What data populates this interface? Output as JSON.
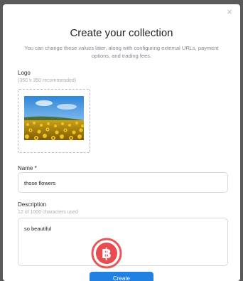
{
  "modal": {
    "close_label": "×",
    "title": "Create your collection",
    "subtitle": "You can change these values later, along with configuring external URLs, payment options, and trading fees."
  },
  "logo": {
    "label": "Logo",
    "hint": "(350 x 350 recommended)"
  },
  "name": {
    "label": "Name *",
    "value": "those flowers"
  },
  "description": {
    "label": "Description",
    "counter": "12 of 1000 characters used",
    "value": "so beautiful"
  },
  "create_button": {
    "label": "Create"
  },
  "colors": {
    "accent": "#2081e2",
    "watermark": "#e4393c"
  }
}
